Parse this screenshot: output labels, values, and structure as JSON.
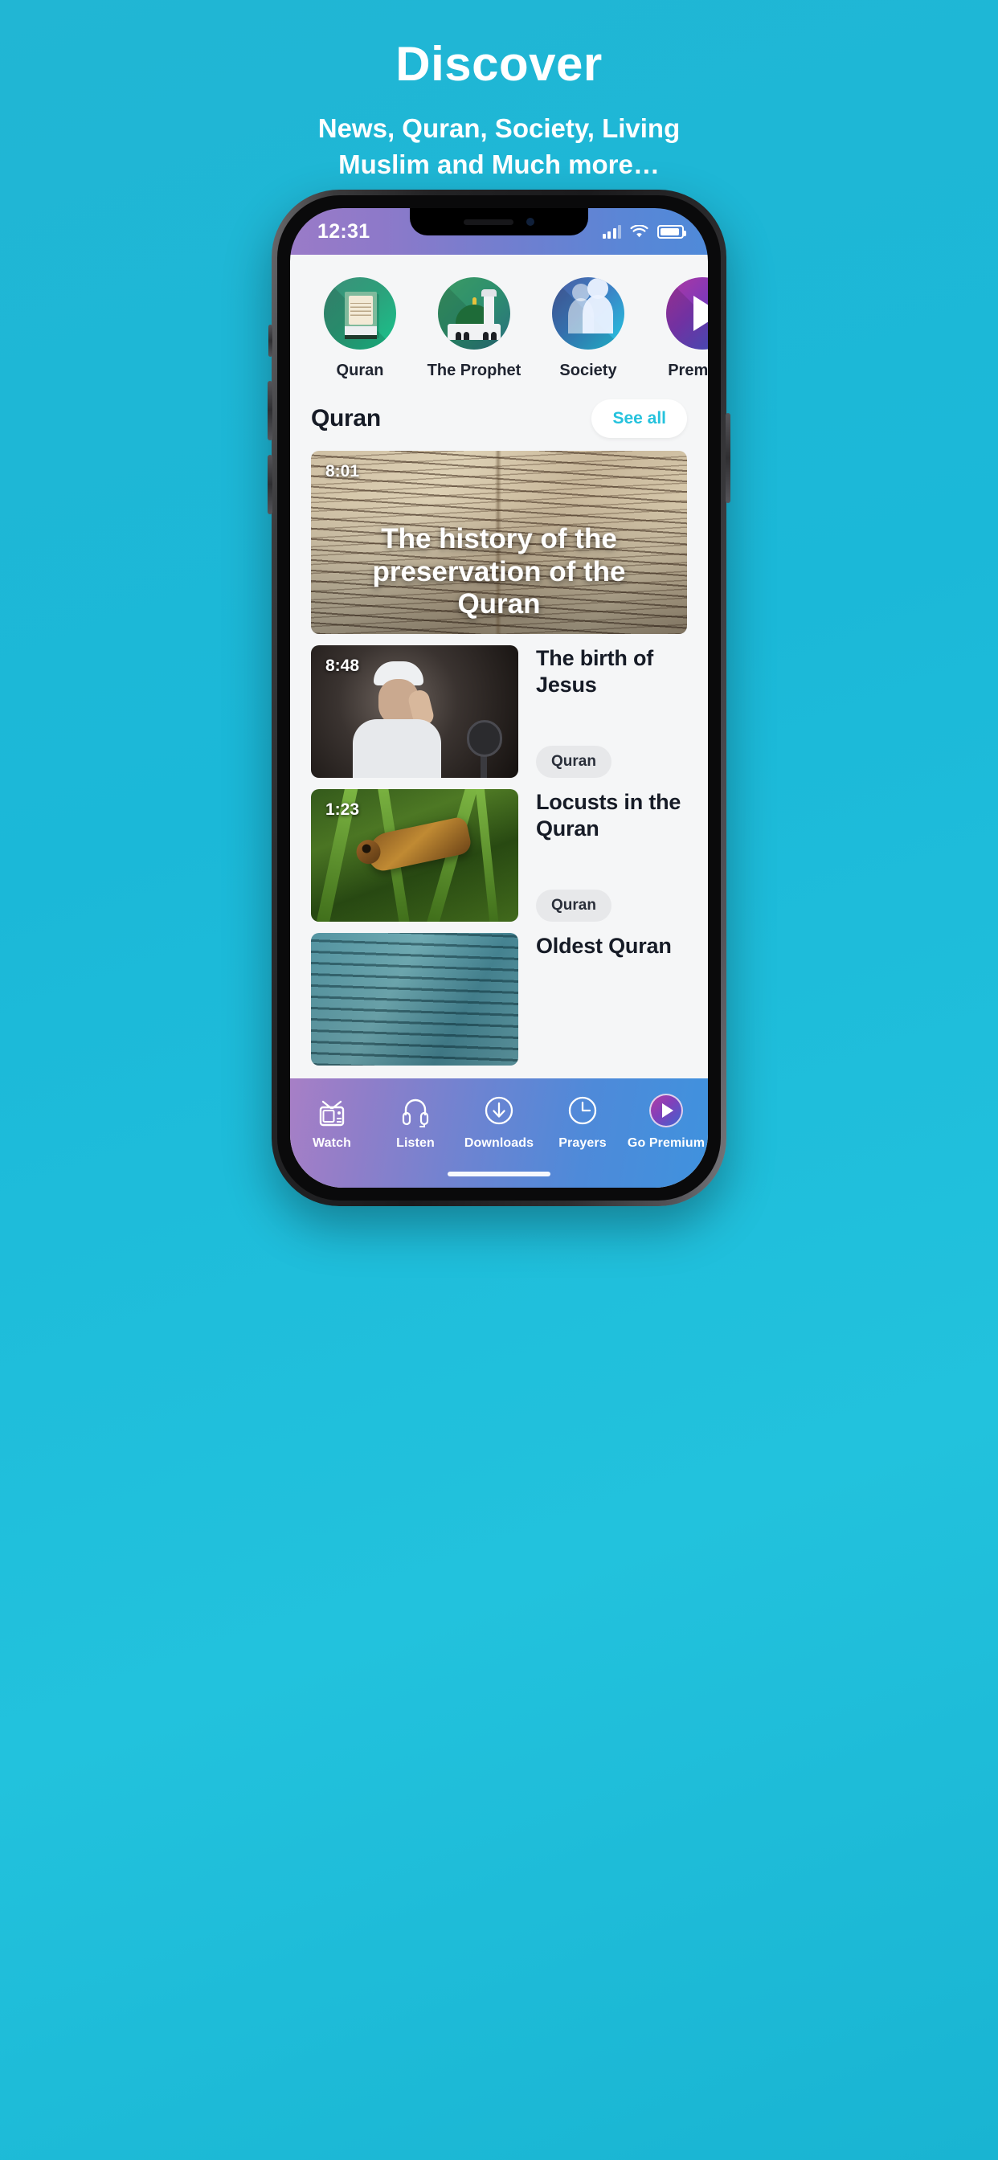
{
  "promo": {
    "title": "Discover",
    "subtitle_line1": "News, Quran, Society, Living",
    "subtitle_line2": "Muslim and Much more…"
  },
  "colors": {
    "background": "#1bb8d8",
    "accent_cyan": "#25c2dd",
    "statusbar_left": "#9a7bc8",
    "statusbar_right": "#4f8ad9",
    "app_background": "#f5f6f7",
    "text_dark": "#161b26"
  },
  "status_bar": {
    "time": "12:31",
    "signal_icon": "signal-bars-icon",
    "wifi_icon": "wifi-icon",
    "battery_icon": "battery-icon"
  },
  "categories": [
    {
      "label": "Quran",
      "icon": "quran-book-icon"
    },
    {
      "label": "The Prophet",
      "icon": "mosque-icon"
    },
    {
      "label": "Society",
      "icon": "people-icon"
    },
    {
      "label": "Premium",
      "icon": "play-icon"
    }
  ],
  "section": {
    "title": "Quran",
    "see_all_label": "See all"
  },
  "featured": {
    "duration": "8:01",
    "title": "The history of the preservation of the Quran"
  },
  "videos": [
    {
      "duration": "8:48",
      "title": "The birth of Jesus",
      "tag": "Quran"
    },
    {
      "duration": "1:23",
      "title": "Locusts in the Quran",
      "tag": "Quran"
    },
    {
      "duration": "",
      "title": "Oldest Quran",
      "tag": ""
    }
  ],
  "tabbar": [
    {
      "label": "Watch",
      "icon": "tv-icon"
    },
    {
      "label": "Listen",
      "icon": "headphones-icon"
    },
    {
      "label": "Downloads",
      "icon": "download-circle-icon"
    },
    {
      "label": "Prayers",
      "icon": "clock-icon"
    },
    {
      "label": "Go Premium",
      "icon": "play-circle-icon"
    }
  ]
}
